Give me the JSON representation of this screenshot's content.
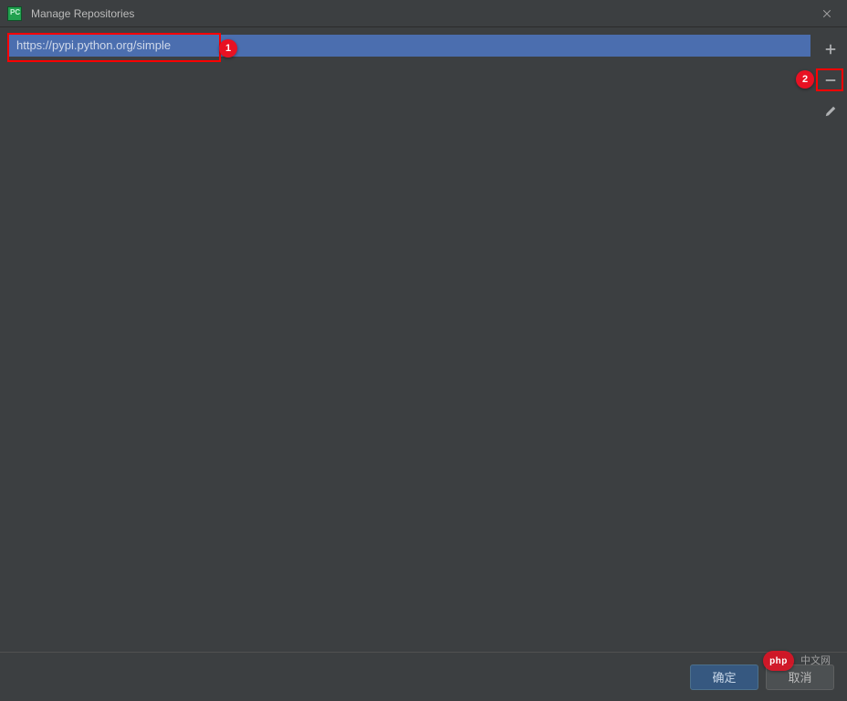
{
  "window": {
    "title": "Manage Repositories"
  },
  "repositories": {
    "items": [
      {
        "url": "https://pypi.python.org/simple"
      }
    ]
  },
  "toolbar": {
    "add_tooltip": "Add",
    "remove_tooltip": "Remove",
    "edit_tooltip": "Edit"
  },
  "buttons": {
    "ok_label": "确定",
    "cancel_label": "取消"
  },
  "annotations": {
    "badge1": "1",
    "badge2": "2"
  },
  "watermark": {
    "badge": "php",
    "text": "中文网"
  }
}
